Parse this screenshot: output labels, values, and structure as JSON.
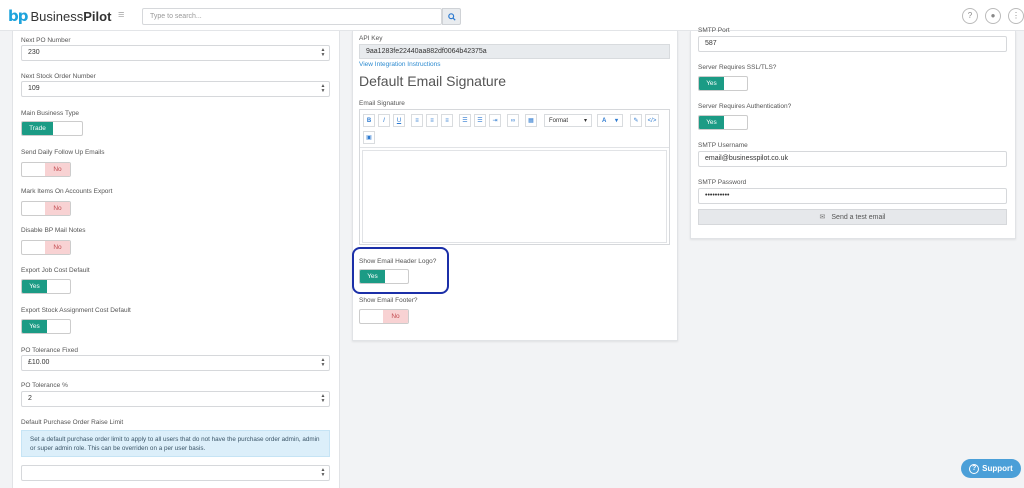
{
  "app": {
    "logo_mark": "bp",
    "logo_name": "Business",
    "logo_name_bold": "Pilot"
  },
  "search": {
    "placeholder": "Type to search..."
  },
  "header_icons": [
    "help-icon",
    "user-icon",
    "more-icon"
  ],
  "left": {
    "next_po_label": "Next PO Number",
    "next_po_value": "230",
    "next_stock_label": "Next Stock Order Number",
    "next_stock_value": "109",
    "business_type_label": "Main Business Type",
    "business_type_value": "Trade",
    "send_daily_label": "Send Daily Follow Up Emails",
    "send_daily_value": "No",
    "mark_items_label": "Mark Items On Accounts Export",
    "mark_items_value": "No",
    "disable_mail_label": "Disable BP Mail Notes",
    "disable_mail_value": "No",
    "export_job_label": "Export Job Cost Default",
    "export_job_value": "Yes",
    "export_stock_label": "Export Stock Assignment Cost Default",
    "export_stock_value": "Yes",
    "po_fixed_label": "PO Tolerance Fixed",
    "po_fixed_value": "£10.00",
    "po_pct_label": "PO Tolerance %",
    "po_pct_value": "2",
    "raise_limit_label": "Default Purchase Order Raise Limit",
    "raise_limit_info": "Set a default purchase order limit to apply to all users that do not have the purchase order admin, admin or super admin role. This can be overriden on a per user basis.",
    "raise_limit_value": ""
  },
  "mid": {
    "api_key_label": "API Key",
    "api_key_value": "9aa1283fe22440aa882df0064b42375a",
    "integration_link": "View Integration Instructions",
    "heading": "Default Email Signature",
    "signature_label": "Email Signature",
    "toolbar": {
      "bold": "B",
      "italic": "I",
      "underline": "U",
      "format": "Format",
      "font_color": "A"
    },
    "show_logo_label": "Show Email Header Logo?",
    "show_logo_value": "Yes",
    "show_footer_label": "Show Email Footer?",
    "show_footer_value": "No"
  },
  "right": {
    "smtp_port_label": "SMTP Port",
    "smtp_port_value": "587",
    "ssl_label": "Server Requires SSL/TLS?",
    "ssl_value": "Yes",
    "auth_label": "Server Requires Authentication?",
    "auth_value": "Yes",
    "username_label": "SMTP Username",
    "username_value": "email@businesspilot.co.uk",
    "password_label": "SMTP Password",
    "password_value": "••••••••••",
    "test_button": "Send a test email"
  },
  "support": {
    "label": "Support"
  },
  "colors": {
    "yes": "#1b9b85",
    "no": "#f8d2d3",
    "accent": "#1ea3dc",
    "highlight": "#1b2fa8"
  }
}
